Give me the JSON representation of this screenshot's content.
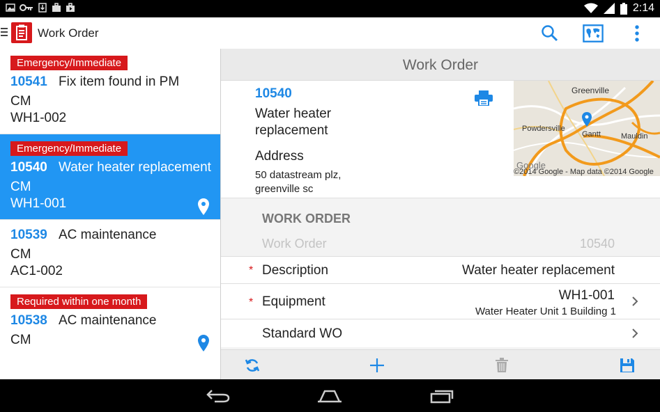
{
  "status_bar": {
    "time": "2:14",
    "icons": [
      "gallery-icon",
      "key-icon",
      "download-icon",
      "briefcase-icon",
      "play-store-icon",
      "wifi-icon",
      "signal-icon",
      "battery-icon"
    ]
  },
  "app_bar": {
    "title": "Work Order",
    "icons": [
      "menu-icon",
      "app-logo-icon",
      "search-icon",
      "map-icon",
      "overflow-menu-icon"
    ]
  },
  "list": {
    "items": [
      {
        "priority": "Emergency/Immediate",
        "id": "10541",
        "title": "Fix item found in PM",
        "type": "CM",
        "code": "WH1-002",
        "pin": false,
        "selected": false
      },
      {
        "priority": "Emergency/Immediate",
        "id": "10540",
        "title": "Water heater replacement",
        "type": "CM",
        "code": "WH1-001",
        "pin": true,
        "selected": true
      },
      {
        "priority": "",
        "id": "10539",
        "title": "AC maintenance",
        "type": "CM",
        "code": "AC1-002",
        "pin": false,
        "selected": false
      },
      {
        "priority": "Required within one month",
        "id": "10538",
        "title": "AC maintenance",
        "type": "CM",
        "code": "",
        "pin": true,
        "selected": false
      }
    ]
  },
  "detail": {
    "header": "Work Order",
    "summary": {
      "id": "10540",
      "description": "Water heater replacement",
      "address_label": "Address",
      "address": "50 datastream plz, greenville sc"
    },
    "map": {
      "labels": [
        "Greenville",
        "Powdersville",
        "Gantt",
        "Mauldin"
      ],
      "attribution": "©2014 Google - Map data ©2014 Google",
      "watermark": "Google"
    },
    "form": {
      "section_title": "WORK ORDER",
      "readonly_label": "Work Order",
      "readonly_value": "10540",
      "rows": [
        {
          "required_mark": "*",
          "label": "Description",
          "value": "Water heater replacement",
          "sub": ""
        },
        {
          "required_mark": "*",
          "label": "Equipment",
          "value": "WH1-001",
          "sub": "Water Heater Unit 1 Building 1"
        },
        {
          "required_mark": "",
          "label": "Standard WO",
          "value": "",
          "sub": ""
        }
      ]
    },
    "actions": [
      "refresh-icon",
      "add-icon",
      "delete-icon",
      "save-icon"
    ]
  },
  "colors": {
    "accent": "#2196f3",
    "brand_red": "#d7191c",
    "link_blue": "#1e88e5"
  }
}
